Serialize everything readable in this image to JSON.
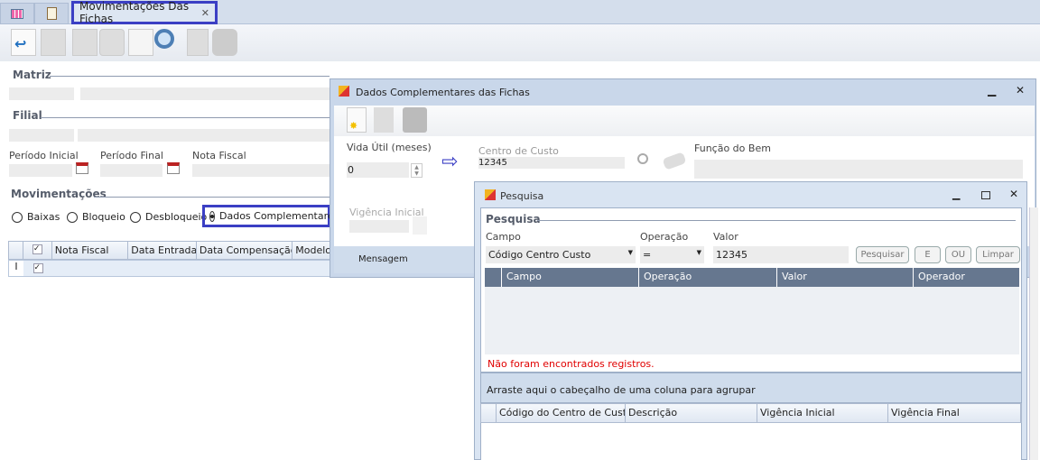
{
  "tabs": {
    "active": "Movimentações Das Fichas",
    "close": "✕"
  },
  "form": {
    "matriz": "Matriz",
    "filial": "Filial",
    "periodo_inicial": "Período Inicial",
    "periodo_final": "Período Final",
    "nota_fiscal": "Nota Fiscal",
    "movimentacoes": "Movimentações",
    "radios": [
      {
        "label": "Baixas",
        "selected": false
      },
      {
        "label": "Bloqueio",
        "selected": false
      },
      {
        "label": "Desbloqueio",
        "selected": false
      },
      {
        "label": "Dados Complementares",
        "selected": true
      }
    ],
    "grid_headers": [
      "Nota Fiscal",
      "Data Entrada",
      "Data Compensação",
      "Modelo"
    ]
  },
  "dados": {
    "title": "Dados Complementares das Fichas",
    "vida_util_label": "Vida Útil (meses)",
    "vida_util_value": "0",
    "centro_custo_label": "Centro de Custo",
    "centro_custo_value": "12345",
    "funcao_bem_label": "Função do Bem",
    "vigencia_inicial_label": "Vigência Inicial",
    "mensagem": "Mensagem"
  },
  "pesquisa": {
    "title": "Pesquisa",
    "section": "Pesquisa",
    "campo_label": "Campo",
    "operacao_label": "Operação",
    "valor_label": "Valor",
    "campo_value": "Código Centro Custo",
    "operacao_value": "=",
    "valor_value": "12345",
    "buttons": {
      "pesquisar": "Pesquisar",
      "e": "E",
      "ou": "OU",
      "limpar": "Limpar"
    },
    "filter_headers": [
      "Campo",
      "Operação",
      "Valor",
      "Operador"
    ],
    "no_records": "Não foram encontrados registros.",
    "group_panel": "Arraste aqui o cabeçalho de uma coluna para agrupar",
    "result_headers": [
      "Código do Centro de Custo",
      "Descrição",
      "Vigência Inicial",
      "Vigência Final"
    ]
  },
  "colors": {
    "highlight": "#3b3fc4",
    "error": "#e00000",
    "grid_header": "#66778f"
  }
}
